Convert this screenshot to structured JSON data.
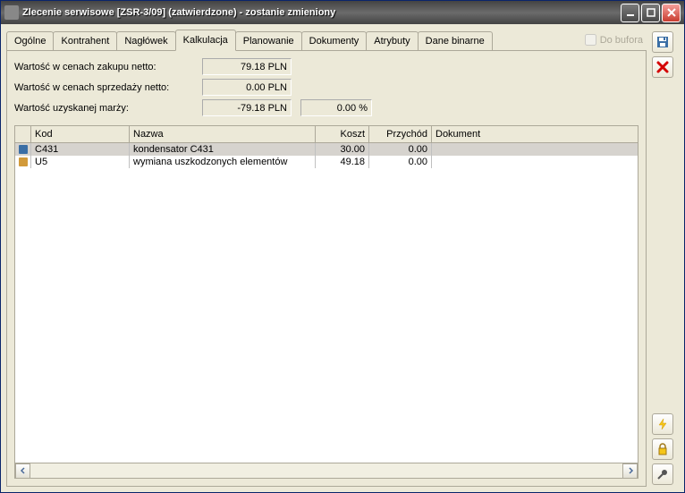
{
  "window": {
    "title": "Zlecenie serwisowe [ZSR-3/09] (zatwierdzone) - zostanie zmieniony"
  },
  "tabs": [
    "Ogólne",
    "Kontrahent",
    "Nagłówek",
    "Kalkulacja",
    "Planowanie",
    "Dokumenty",
    "Atrybuty",
    "Dane binarne"
  ],
  "active_tab": 3,
  "buffer_label": "Do bufora",
  "summary": {
    "purchase_label": "Wartość w cenach zakupu netto:",
    "purchase_val": "79.18 PLN",
    "sale_label": "Wartość w cenach sprzedaży netto:",
    "sale_val": "0.00 PLN",
    "margin_label": "Wartość uzyskanej marży:",
    "margin_val": "-79.18 PLN",
    "margin_pct": "0.00 %"
  },
  "grid": {
    "headers": {
      "kod": "Kod",
      "nazwa": "Nazwa",
      "koszt": "Koszt",
      "przychod": "Przychód",
      "dokument": "Dokument"
    },
    "rows": [
      {
        "kod": "C431",
        "nazwa": "kondensator C431",
        "koszt": "30.00",
        "przychod": "0.00",
        "dokument": "",
        "selected": true,
        "icon_color": "#3a6ea5"
      },
      {
        "kod": "U5",
        "nazwa": "wymiana uszkodzonych elementów",
        "koszt": "49.18",
        "przychod": "0.00",
        "dokument": "",
        "selected": false,
        "icon_color": "#d29a3a"
      }
    ]
  }
}
